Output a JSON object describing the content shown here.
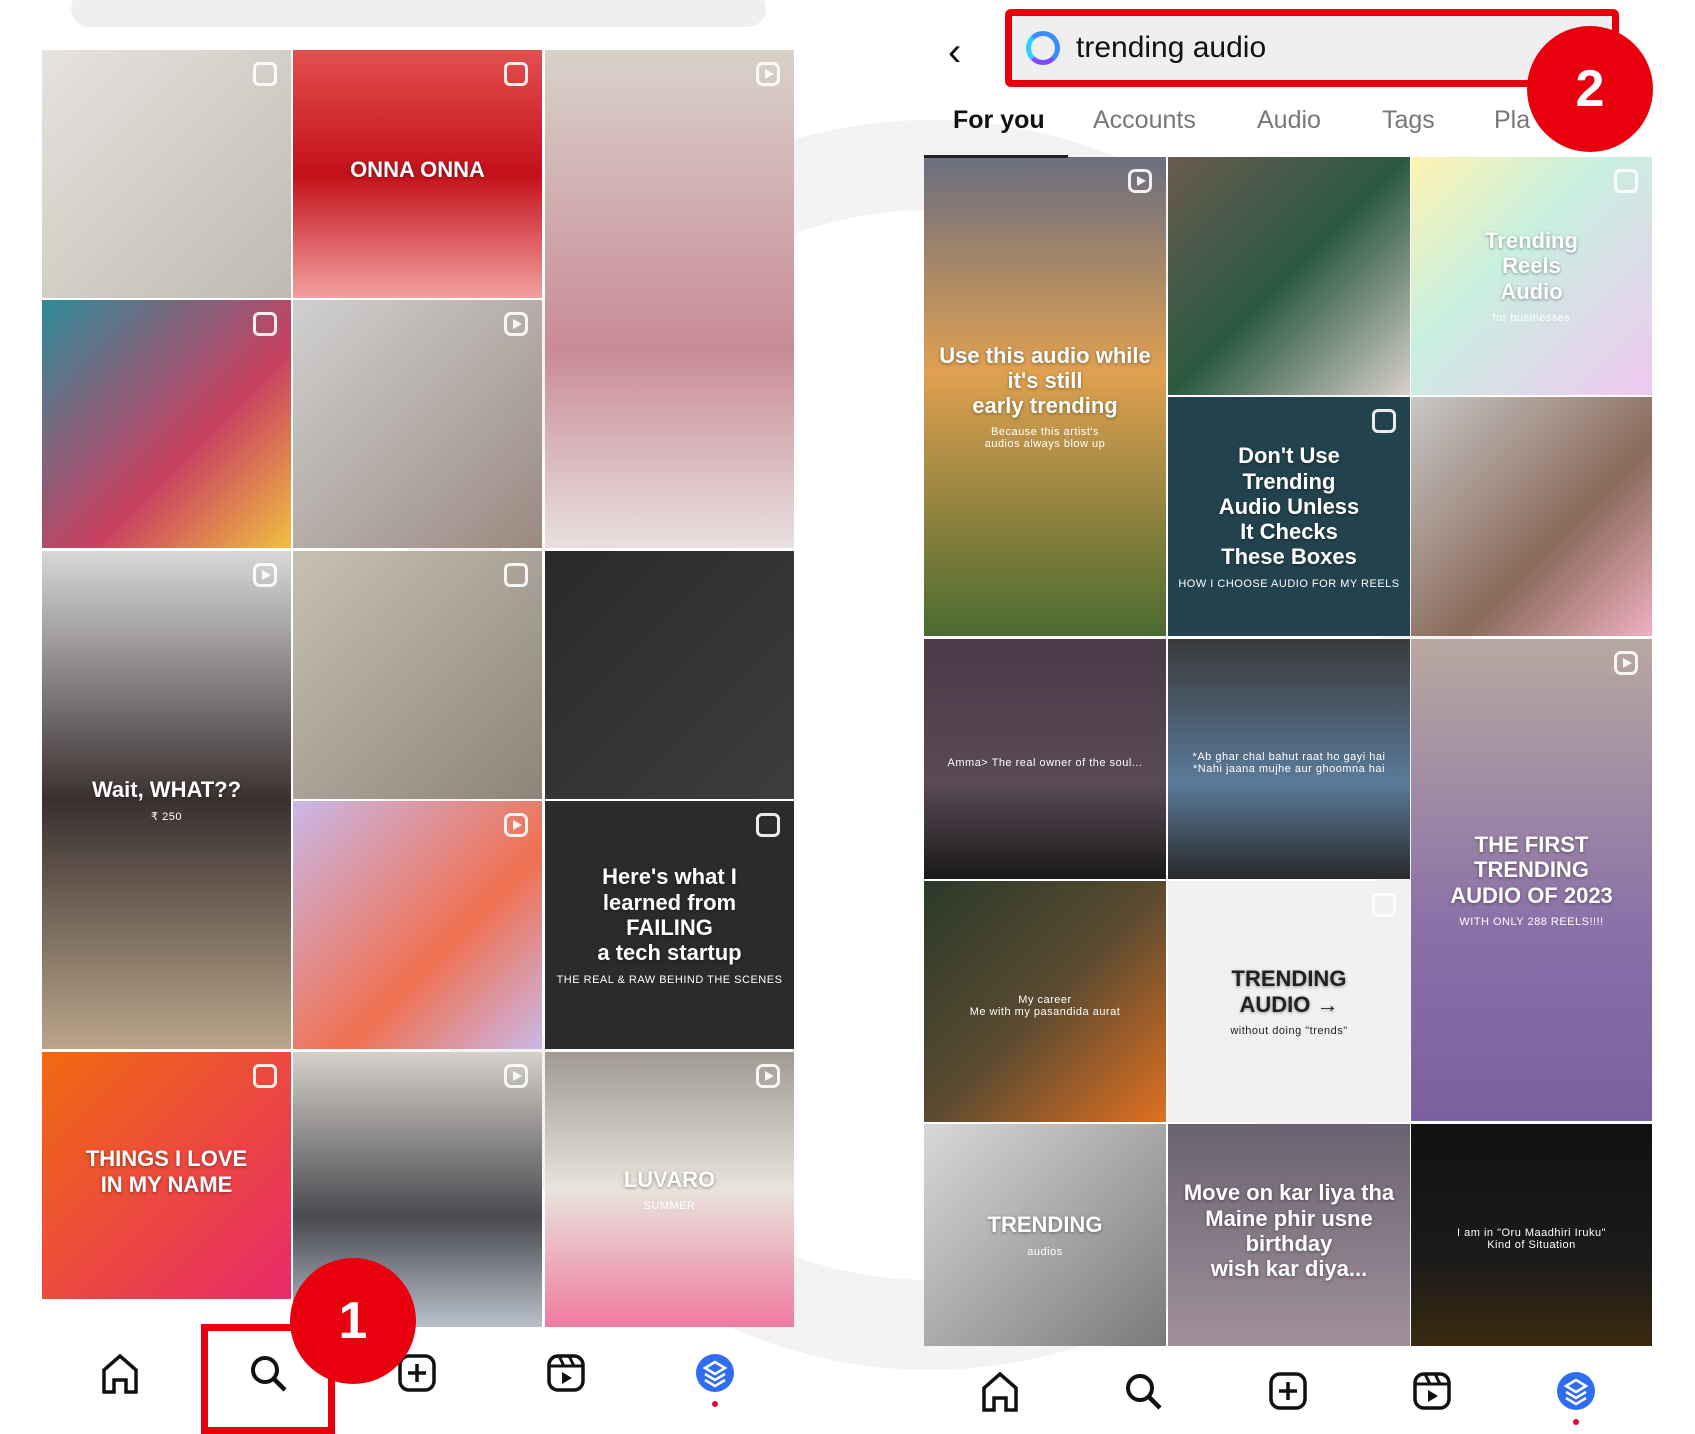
{
  "left_screen": {
    "grid": [
      {
        "caption": "",
        "sub": "",
        "icon": "carousel-icon",
        "bg": "linear-gradient(135deg,#e6e3de,#bfbab2)"
      },
      {
        "caption": "ONNA   ONNA",
        "sub": "",
        "icon": "carousel-icon",
        "bg": "linear-gradient(180deg,#e25050,#c4101a 50%,#f2a0a0)"
      },
      {
        "caption": "",
        "sub": "",
        "icon": "reel-icon",
        "bg": "linear-gradient(180deg,#d9d2c8,#c98b95 60%,#e8e0e0)"
      },
      {
        "caption": "",
        "sub": "",
        "icon": "carousel-icon",
        "bg": "linear-gradient(135deg,#2e8c9a,#c94060 60%,#f0c040)"
      },
      {
        "caption": "",
        "sub": "",
        "icon": "reel-icon",
        "bg": "linear-gradient(135deg,#d0d0d0,#9a8a80)"
      },
      {
        "caption": "Wait, WHAT??",
        "sub": "₹ 250",
        "icon": "reel-icon",
        "bg": "linear-gradient(180deg,#d8d8d8,#3a3030 50%,#b9a58a)"
      },
      {
        "caption": "",
        "sub": "",
        "icon": "carousel-icon",
        "bg": "linear-gradient(135deg,#c8c0b5,#8e8478)"
      },
      {
        "caption": "",
        "sub": "",
        "icon": "",
        "bg": "linear-gradient(135deg,#2a2a2a,#3d3d3d)"
      },
      {
        "caption": "",
        "sub": "",
        "icon": "reel-icon",
        "bg": "linear-gradient(135deg,#c9b8e8,#f07050 60%,#c9b8e8)"
      },
      {
        "caption": "Here's what I\nlearned from\nFAILING\na tech startup",
        "sub": "THE REAL & RAW BEHIND THE SCENES",
        "icon": "carousel-icon",
        "bg": "#2b2b2b"
      },
      {
        "caption": "THINGS I LOVE\nIN MY NAME",
        "sub": "",
        "icon": "carousel-icon",
        "bg": "linear-gradient(135deg,#f06a10,#e82a6a)"
      },
      {
        "caption": "",
        "sub": "",
        "icon": "reel-icon",
        "bg": "linear-gradient(180deg,#d5d0ca,#4a4a50 60%,#b8c0cc)"
      },
      {
        "caption": "LUVARO",
        "sub": "SUMMER",
        "icon": "reel-icon",
        "bg": "linear-gradient(180deg,#a09a92,#e8e4dc 50%,#f07aa0)"
      }
    ],
    "nav": [
      "home-icon",
      "search-icon",
      "create-icon",
      "reels-icon",
      "profile-icon"
    ]
  },
  "annotations": {
    "step1": "1",
    "step2": "2",
    "highlight_color": "#e8000f"
  },
  "right_screen": {
    "back_label": "‹",
    "search": {
      "value": "trending audio"
    },
    "tabs": [
      {
        "label": "For you"
      },
      {
        "label": "Accounts"
      },
      {
        "label": "Audio"
      },
      {
        "label": "Tags"
      },
      {
        "label": "Pla"
      }
    ],
    "grid": [
      {
        "caption": "Use this audio while it's still\nearly trending",
        "sub": "Because this artist's\naudios always blow up",
        "icon": "reel-icon",
        "bg": "linear-gradient(180deg,#6a6e80,#e0a050 45%,#4a6a30)"
      },
      {
        "caption": "",
        "sub": "",
        "icon": "",
        "bg": "linear-gradient(135deg,#6a5a50,#2a5a40 50%,#d8d0c8)"
      },
      {
        "caption": "Trending\nReels\nAudio",
        "sub": "for businesses",
        "icon": "carousel-icon",
        "bg": "linear-gradient(135deg,#fff3b0,#c8f0e0 40%,#f0c8f0)"
      },
      {
        "caption": "Don't Use\nTrending\nAudio Unless\nIt Checks\nThese Boxes",
        "sub": "HOW I CHOOSE AUDIO FOR MY REELS",
        "icon": "carousel-icon",
        "bg": "#22434e"
      },
      {
        "caption": "",
        "sub": "",
        "icon": "",
        "bg": "linear-gradient(135deg,#c8c8c8,#8a6a5a 60%,#f0b0c0)"
      },
      {
        "caption": "",
        "sub": "Amma> The real owner of the soul...",
        "icon": "",
        "bg": "linear-gradient(180deg,#4a3a48,#5a4a55 60%,#1a1a1a)"
      },
      {
        "caption": "",
        "sub": "*Ab ghar chal bahut raat ho gayi hai\n*Nahi jaana mujhe aur ghoomna hai",
        "icon": "",
        "bg": "linear-gradient(180deg,#3a3a3a,#5a7a9a 60%,#2a2a2a)"
      },
      {
        "caption": "THE FIRST TRENDING\nAUDIO OF 2023",
        "sub": "WITH ONLY 288 REELS!!!!",
        "icon": "reel-icon",
        "bg": "linear-gradient(180deg,#b8a8a0,#8a70a8 60%,#7a60a0)"
      },
      {
        "caption": "",
        "sub": "My career\nMe with my pasandida aurat",
        "icon": "",
        "bg": "linear-gradient(135deg,#2a3a2a,#5a4a30 50%,#e07020)"
      },
      {
        "caption": "TRENDING\nAUDIO →",
        "sub": "without doing \"trends\"",
        "icon": "carousel-icon",
        "bg": "#f2f1ef"
      },
      {
        "caption": "TRENDING",
        "sub": "audios",
        "icon": "",
        "bg": "linear-gradient(135deg,#d8d8d8,#7a7a7a)"
      },
      {
        "caption": "Move on kar liya tha\nMaine phir usne\nbirthday\nwish kar diya...",
        "sub": "",
        "icon": "",
        "bg": "linear-gradient(180deg,#6a6272,#a0909a)"
      },
      {
        "caption": "",
        "sub": "I am in \"Oru Maadhiri Iruku\"\nKind of Situation",
        "icon": "",
        "bg": "linear-gradient(180deg,#111,#1a1a1a 60%,#3a2a10)"
      }
    ],
    "nav": [
      "home-icon",
      "search-icon",
      "create-icon",
      "reels-icon",
      "profile-icon"
    ]
  }
}
